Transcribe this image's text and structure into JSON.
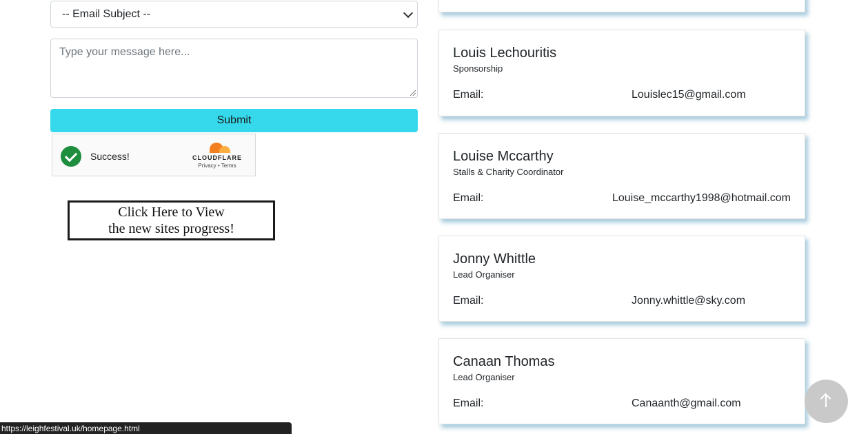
{
  "form": {
    "subject_select": "-- Email Subject --",
    "message_placeholder": "Type your message here...",
    "submit_label": "Submit"
  },
  "captcha": {
    "status": "Success!",
    "brand": "CLOUDFLARE",
    "privacy": "Privacy",
    "separator": "•",
    "terms": "Terms"
  },
  "progress_link": {
    "line1": "Click Here to View",
    "line2": "the new sites progress!"
  },
  "contacts": [
    {
      "name": "Louis Lechouritis",
      "role": "Sponsorship",
      "email_label": "Email:",
      "email": "Louislec15@gmail.com"
    },
    {
      "name": "Louise Mccarthy",
      "role": "Stalls & Charity Coordinator",
      "email_label": "Email:",
      "email": "Louise_mccarthy1998@hotmail.com"
    },
    {
      "name": "Jonny Whittle",
      "role": "Lead Organiser",
      "email_label": "Email:",
      "email": "Jonny.whittle@sky.com"
    },
    {
      "name": "Canaan Thomas",
      "role": "Lead Organiser",
      "email_label": "Email:",
      "email": "Canaanth@gmail.com"
    }
  ],
  "status_bar": {
    "url": "https://leighfestival.uk/homepage.html"
  },
  "colors": {
    "submit_bg": "#36d9ec",
    "check_green": "#1e8e3e",
    "card_shadow": "#3c8cb4"
  }
}
